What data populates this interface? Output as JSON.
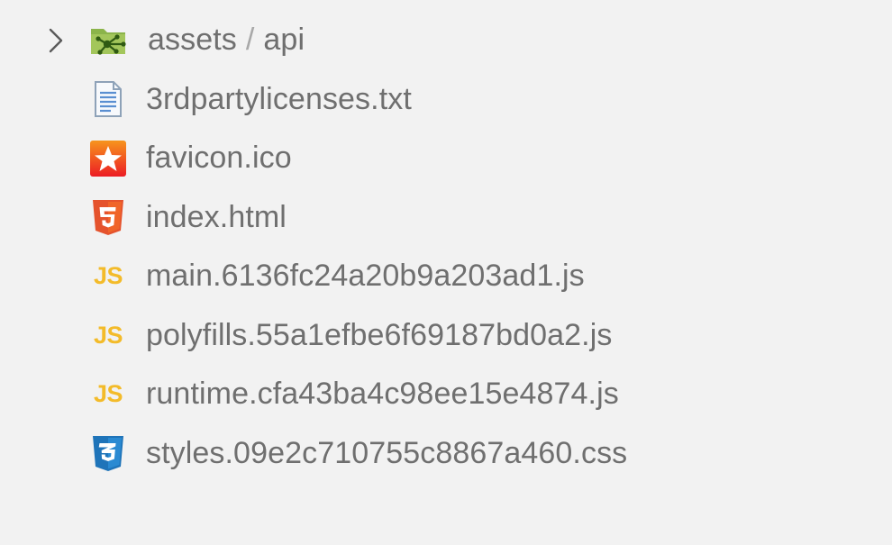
{
  "explorer": {
    "folder": {
      "name": "assets",
      "separator": "/",
      "child": "api",
      "icon": "folder-api-icon",
      "expanded": false
    },
    "files": [
      {
        "name": "3rdpartylicenses.txt",
        "icon": "text-file-icon"
      },
      {
        "name": "favicon.ico",
        "icon": "favicon-star-icon"
      },
      {
        "name": "index.html",
        "icon": "html5-icon"
      },
      {
        "name": "main.6136fc24a20b9a203ad1.js",
        "icon": "js-icon"
      },
      {
        "name": "polyfills.55a1efbe6f69187bd0a2.js",
        "icon": "js-icon"
      },
      {
        "name": "runtime.cfa43ba4c98ee15e4874.js",
        "icon": "js-icon"
      },
      {
        "name": "styles.09e2c710755c8867a460.css",
        "icon": "css3-icon"
      }
    ],
    "js_badge": "JS",
    "html_badge": "5",
    "css_badge": "3"
  },
  "colors": {
    "background": "#f2f2f2",
    "text": "#6f6f6f",
    "js": "#f3bb2a",
    "html": "#e5532d",
    "css": "#1f74b9",
    "folder": "#8bb44a"
  }
}
